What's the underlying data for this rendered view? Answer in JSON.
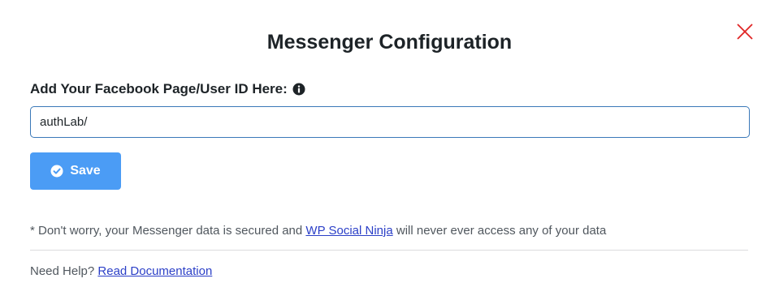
{
  "dialog": {
    "title": "Messenger Configuration"
  },
  "form": {
    "label": "Add Your Facebook Page/User ID Here:",
    "input_value": "authLab/",
    "save_label": "Save"
  },
  "notice": {
    "prefix": "* Don't worry, your Messenger data is secured and ",
    "link_text": "WP Social Ninja",
    "suffix": " will never ever access any of your data"
  },
  "help": {
    "prefix": "Need Help? ",
    "link_text": "Read Documentation"
  },
  "icons": {
    "close": "close-icon",
    "info": "info-icon",
    "save": "check-circle-icon"
  },
  "colors": {
    "primary_button": "#4b9cf5",
    "close_icon": "#e02424",
    "link": "#2b3fc7",
    "input_border": "#3a78b8"
  }
}
